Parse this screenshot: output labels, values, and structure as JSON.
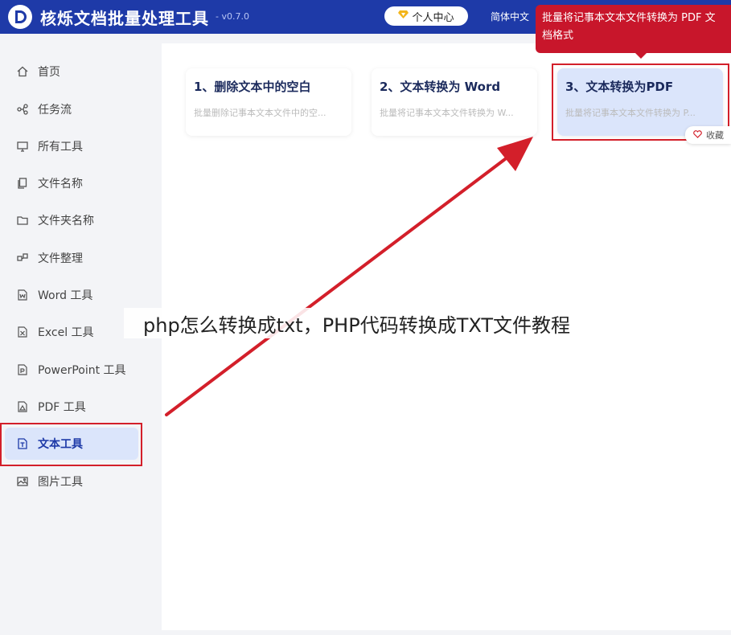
{
  "header": {
    "title": "核烁文档批量处理工具",
    "version": "- v0.7.0",
    "user_center": "个人中心",
    "language": "简体中文",
    "logo_icon": "logo-d-icon",
    "user_icon": "diamond-icon"
  },
  "sidebar": {
    "items": [
      {
        "label": "首页",
        "icon": "home-icon"
      },
      {
        "label": "任务流",
        "icon": "workflow-icon"
      },
      {
        "label": "所有工具",
        "icon": "monitor-icon"
      },
      {
        "label": "文件名称",
        "icon": "file-copy-icon"
      },
      {
        "label": "文件夹名称",
        "icon": "folder-icon"
      },
      {
        "label": "文件整理",
        "icon": "organize-icon"
      },
      {
        "label": "Word 工具",
        "icon": "word-file-icon"
      },
      {
        "label": "Excel 工具",
        "icon": "excel-file-icon"
      },
      {
        "label": "PowerPoint 工具",
        "icon": "ppt-file-icon"
      },
      {
        "label": "PDF 工具",
        "icon": "pdf-file-icon"
      },
      {
        "label": "文本工具",
        "icon": "text-file-icon"
      },
      {
        "label": "图片工具",
        "icon": "image-icon"
      }
    ],
    "active_index": 10
  },
  "tools": [
    {
      "title": "1、删除文本中的空白",
      "desc": "批量删除记事本文本文件中的空..."
    },
    {
      "title": "2、文本转换为 Word",
      "desc": "批量将记事本文本文件转换为 W..."
    },
    {
      "title": "3、文本转换为PDF",
      "desc": "批量将记事本文本文件转换为 P..."
    }
  ],
  "favorite_label": "收藏",
  "favorite_icon": "heart-icon",
  "tooltip": "批量将记事本文本文件转换为 PDF 文档格式",
  "caption": "php怎么转换成txt，PHP代码转换成TXT文件教程",
  "colors": {
    "header_bg": "#1e3aa8",
    "accent_red": "#d31f2a",
    "active_bg": "#dbe5fb"
  }
}
